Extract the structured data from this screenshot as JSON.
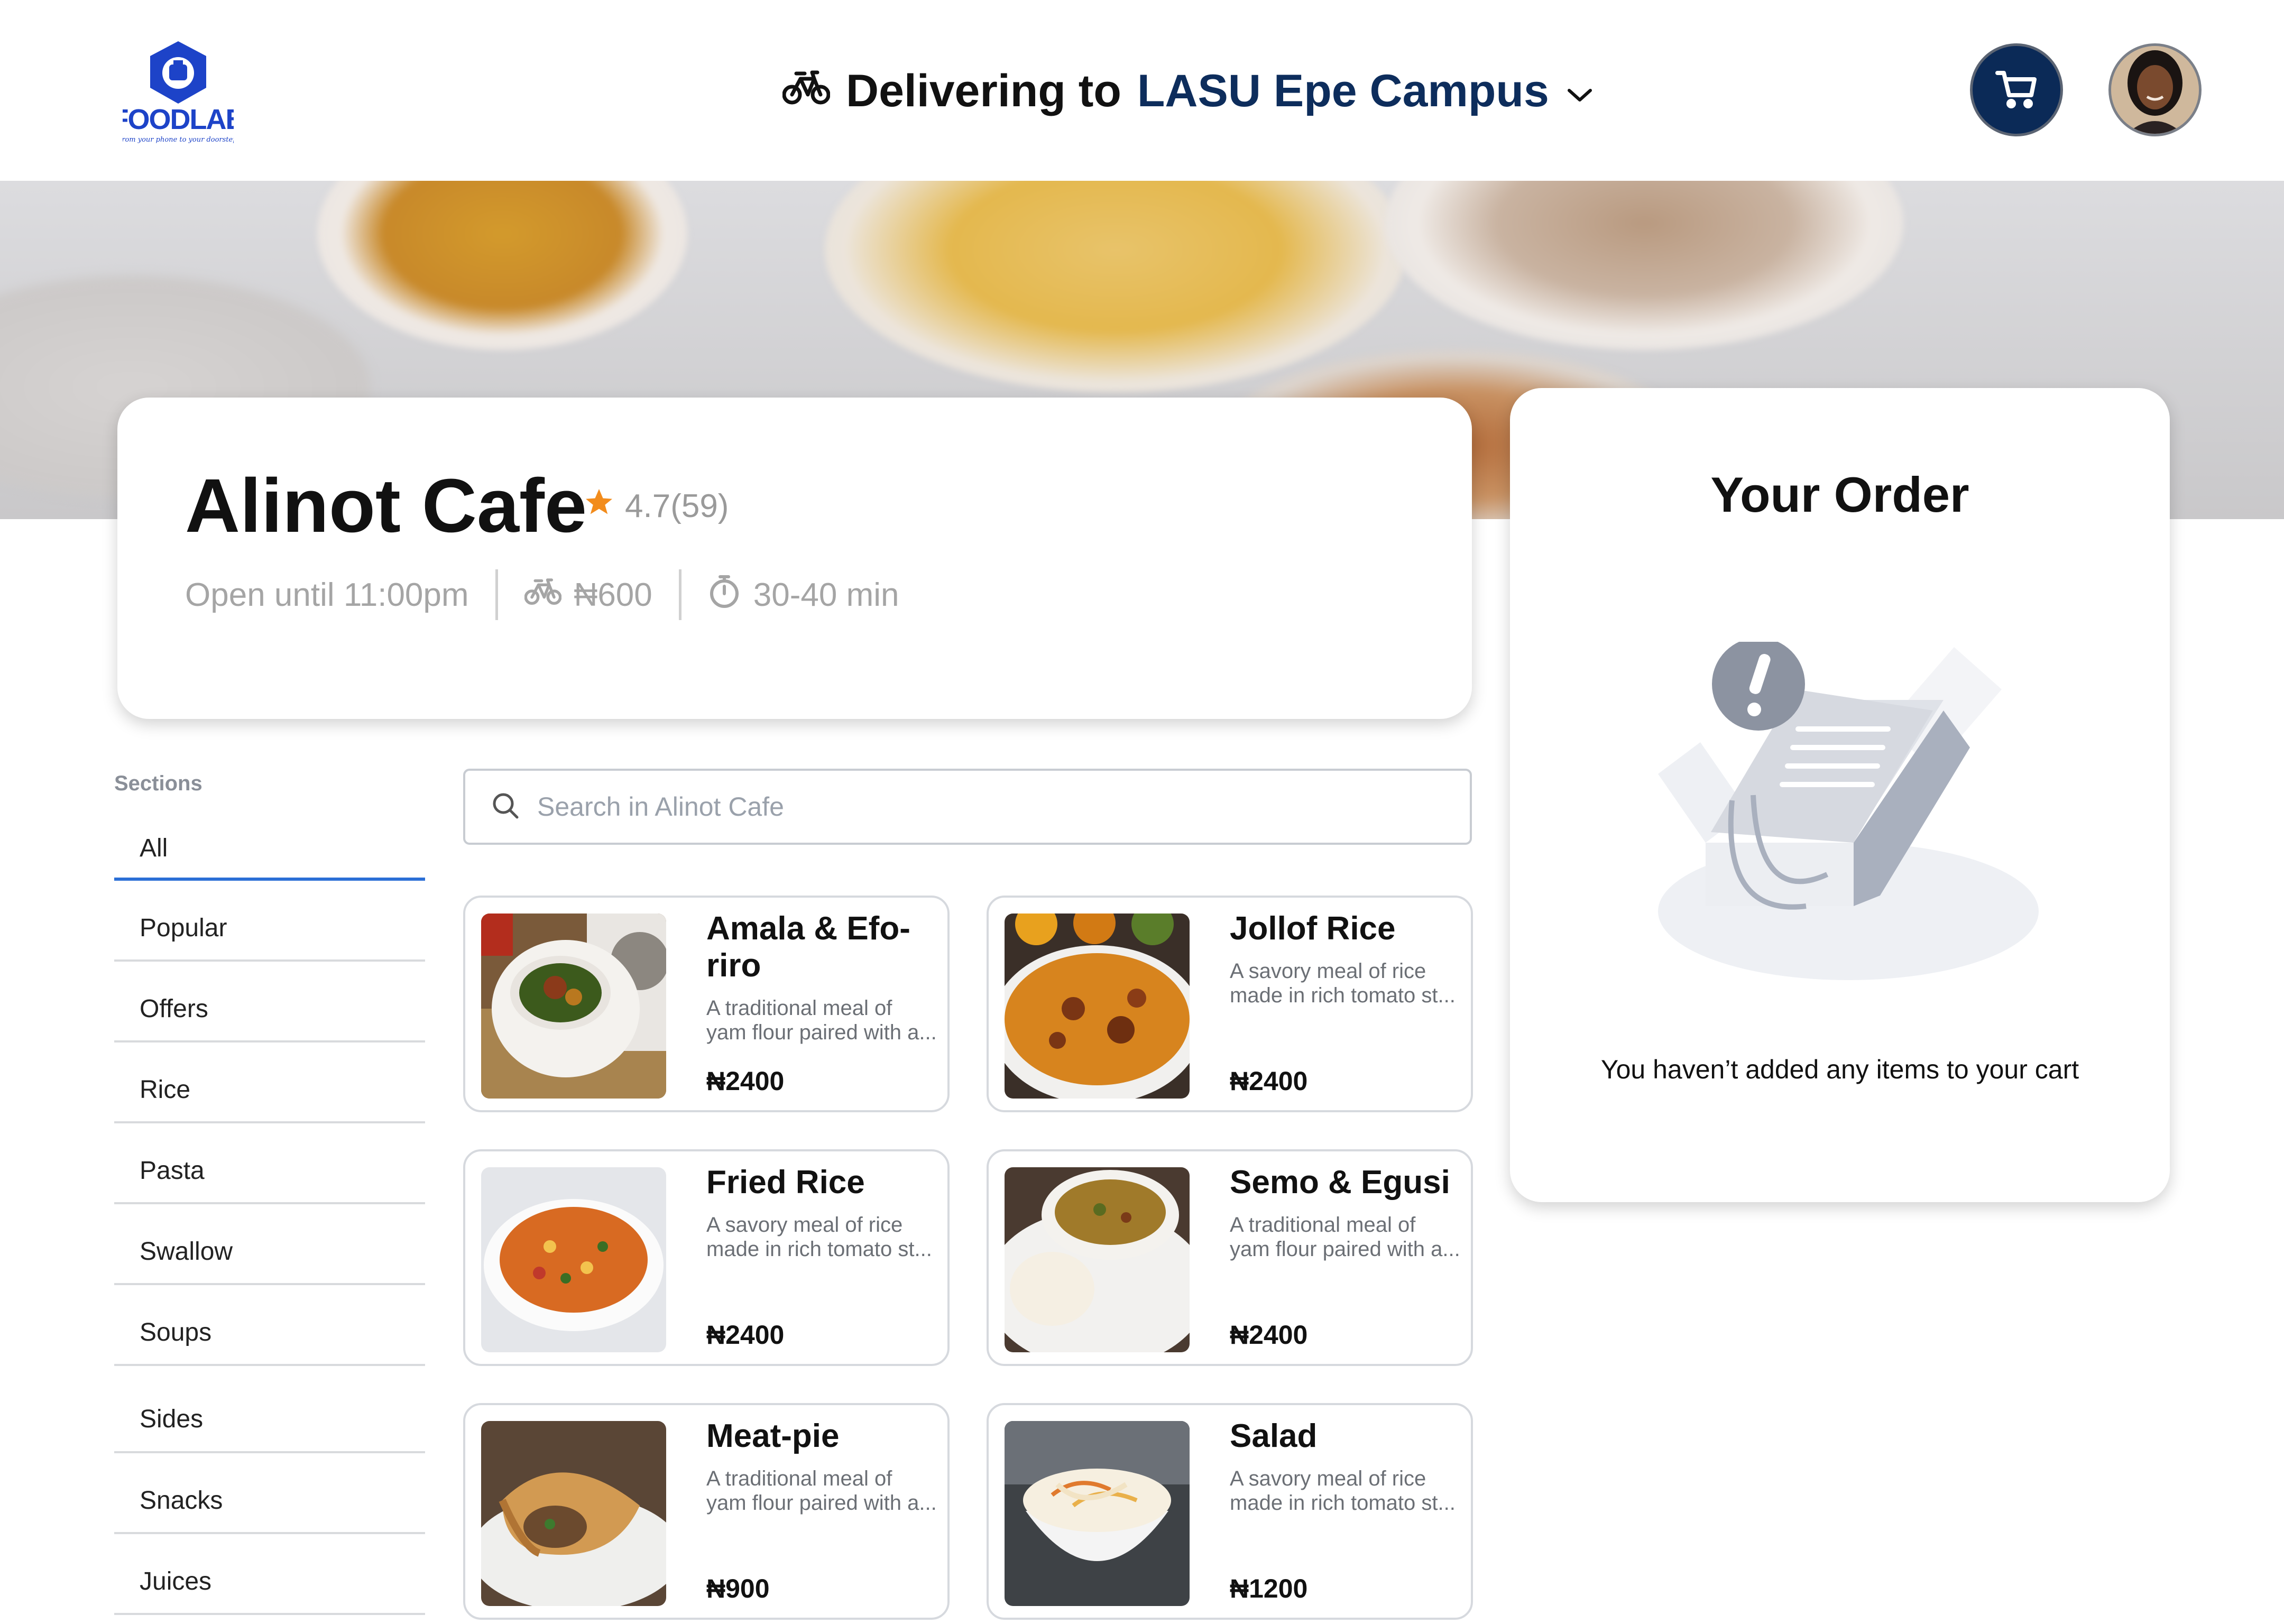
{
  "header": {
    "logo_text": "FOODLAB",
    "logo_tagline": "from your phone to your doorstep",
    "delivery_prefix": "Delivering to",
    "delivery_location": "LASU Epe Campus"
  },
  "restaurant": {
    "name": "Alinot Cafe",
    "rating": "4.7(59)",
    "hours": "Open until 11:00pm",
    "delivery_fee": "₦600",
    "delivery_time": "30-40 min"
  },
  "sidebar": {
    "label": "Sections",
    "items": [
      {
        "label": "All",
        "active": true
      },
      {
        "label": "Popular"
      },
      {
        "label": "Offers"
      },
      {
        "label": "Rice"
      },
      {
        "label": "Pasta"
      },
      {
        "label": "Swallow"
      },
      {
        "label": "Soups"
      },
      {
        "label": "Sides"
      },
      {
        "label": "Snacks"
      },
      {
        "label": "Juices"
      }
    ]
  },
  "search": {
    "placeholder": "Search in Alinot Cafe"
  },
  "products": [
    {
      "name": "Amala & Efo-riro",
      "desc_line1": "A traditional meal of",
      "desc_line2": "yam flour paired with a...",
      "price": "₦2400"
    },
    {
      "name": "Jollof Rice",
      "desc_line1": "A savory meal of rice",
      "desc_line2": "made in rich tomato st...",
      "price": "₦2400"
    },
    {
      "name": "Fried Rice",
      "desc_line1": "A savory meal of rice",
      "desc_line2": "made in rich tomato st...",
      "price": "₦2400"
    },
    {
      "name": "Semo & Egusi",
      "desc_line1": "A traditional meal of",
      "desc_line2": "yam flour paired with a...",
      "price": "₦2400"
    },
    {
      "name": "Meat-pie",
      "desc_line1": "A traditional meal of",
      "desc_line2": "yam flour paired with a...",
      "price": "₦900"
    },
    {
      "name": "Salad",
      "desc_line1": "A savory meal of rice",
      "desc_line2": "made in rich tomato st...",
      "price": "₦1200"
    }
  ],
  "order": {
    "title": "Your Order",
    "empty_message": "You haven’t added any items to your cart"
  },
  "colors": {
    "brand_navy": "#0b2a57",
    "accent_blue": "#2b6fd6",
    "star_orange": "#f28c1c"
  },
  "icons": [
    "bicycle-icon",
    "chevron-down-icon",
    "cart-icon",
    "star-icon",
    "clock-icon",
    "search-icon"
  ]
}
